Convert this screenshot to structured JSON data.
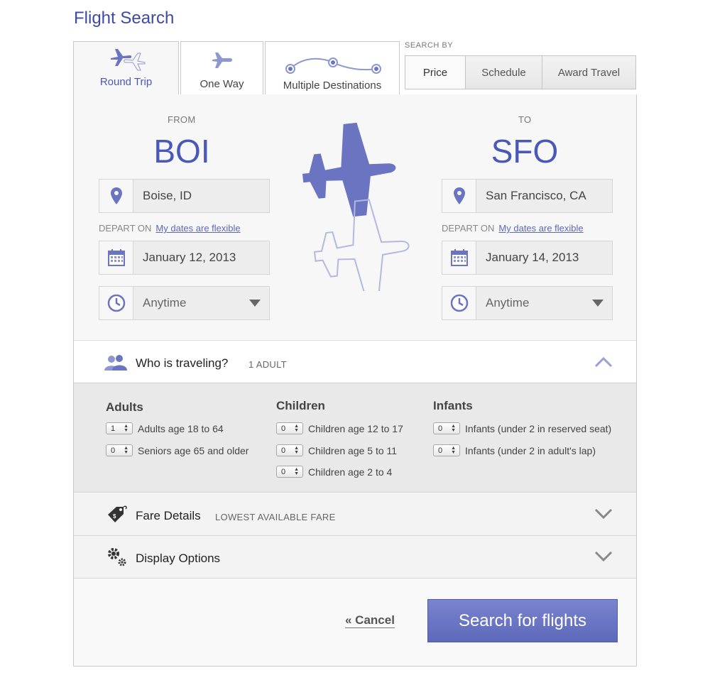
{
  "page_title": "Flight Search",
  "trip_tabs": [
    {
      "label": "Round Trip",
      "active": true,
      "icon": "round-trip-planes-icon"
    },
    {
      "label": "One Way",
      "active": false,
      "icon": "airplane-icon"
    },
    {
      "label": "Multiple Destinations",
      "active": false,
      "icon": "multi-stop-route-icon"
    }
  ],
  "search_by": {
    "label": "SEARCH BY",
    "options": [
      {
        "label": "Price",
        "active": true
      },
      {
        "label": "Schedule",
        "active": false
      },
      {
        "label": "Award Travel",
        "active": false
      }
    ]
  },
  "from": {
    "label": "FROM",
    "code": "BOI",
    "city": "Boise, ID",
    "depart_label": "DEPART ON",
    "flexible_link": "My dates are flexible",
    "date": "January 12, 2013",
    "time": "Anytime"
  },
  "to": {
    "label": "TO",
    "code": "SFO",
    "city": "San Francisco, CA",
    "depart_label": "DEPART ON",
    "flexible_link": "My dates are flexible",
    "date": "January 14, 2013",
    "time": "Anytime"
  },
  "travelers": {
    "title": "Who is traveling?",
    "summary": "1 ADULT",
    "groups": [
      {
        "title": "Adults",
        "rows": [
          {
            "count": "1",
            "label": "Adults age 18 to 64"
          },
          {
            "count": "0",
            "label": "Seniors age 65 and older"
          }
        ]
      },
      {
        "title": "Children",
        "rows": [
          {
            "count": "0",
            "label": "Children age 12 to 17"
          },
          {
            "count": "0",
            "label": "Children age 5 to 11"
          },
          {
            "count": "0",
            "label": "Children age 2 to 4"
          }
        ]
      },
      {
        "title": "Infants",
        "rows": [
          {
            "count": "0",
            "label": "Infants (under 2 in reserved seat)"
          },
          {
            "count": "0",
            "label": "Infants (under 2 in adult's lap)"
          }
        ]
      }
    ]
  },
  "fare_details": {
    "title": "Fare Details",
    "subtitle": "LOWEST AVAILABLE FARE"
  },
  "display_options": {
    "title": "Display Options"
  },
  "actions": {
    "cancel": "« Cancel",
    "search": "Search for flights"
  },
  "colors": {
    "accent": "#4a58b8",
    "button": "#6873c2",
    "icon": "#6a74c0"
  }
}
